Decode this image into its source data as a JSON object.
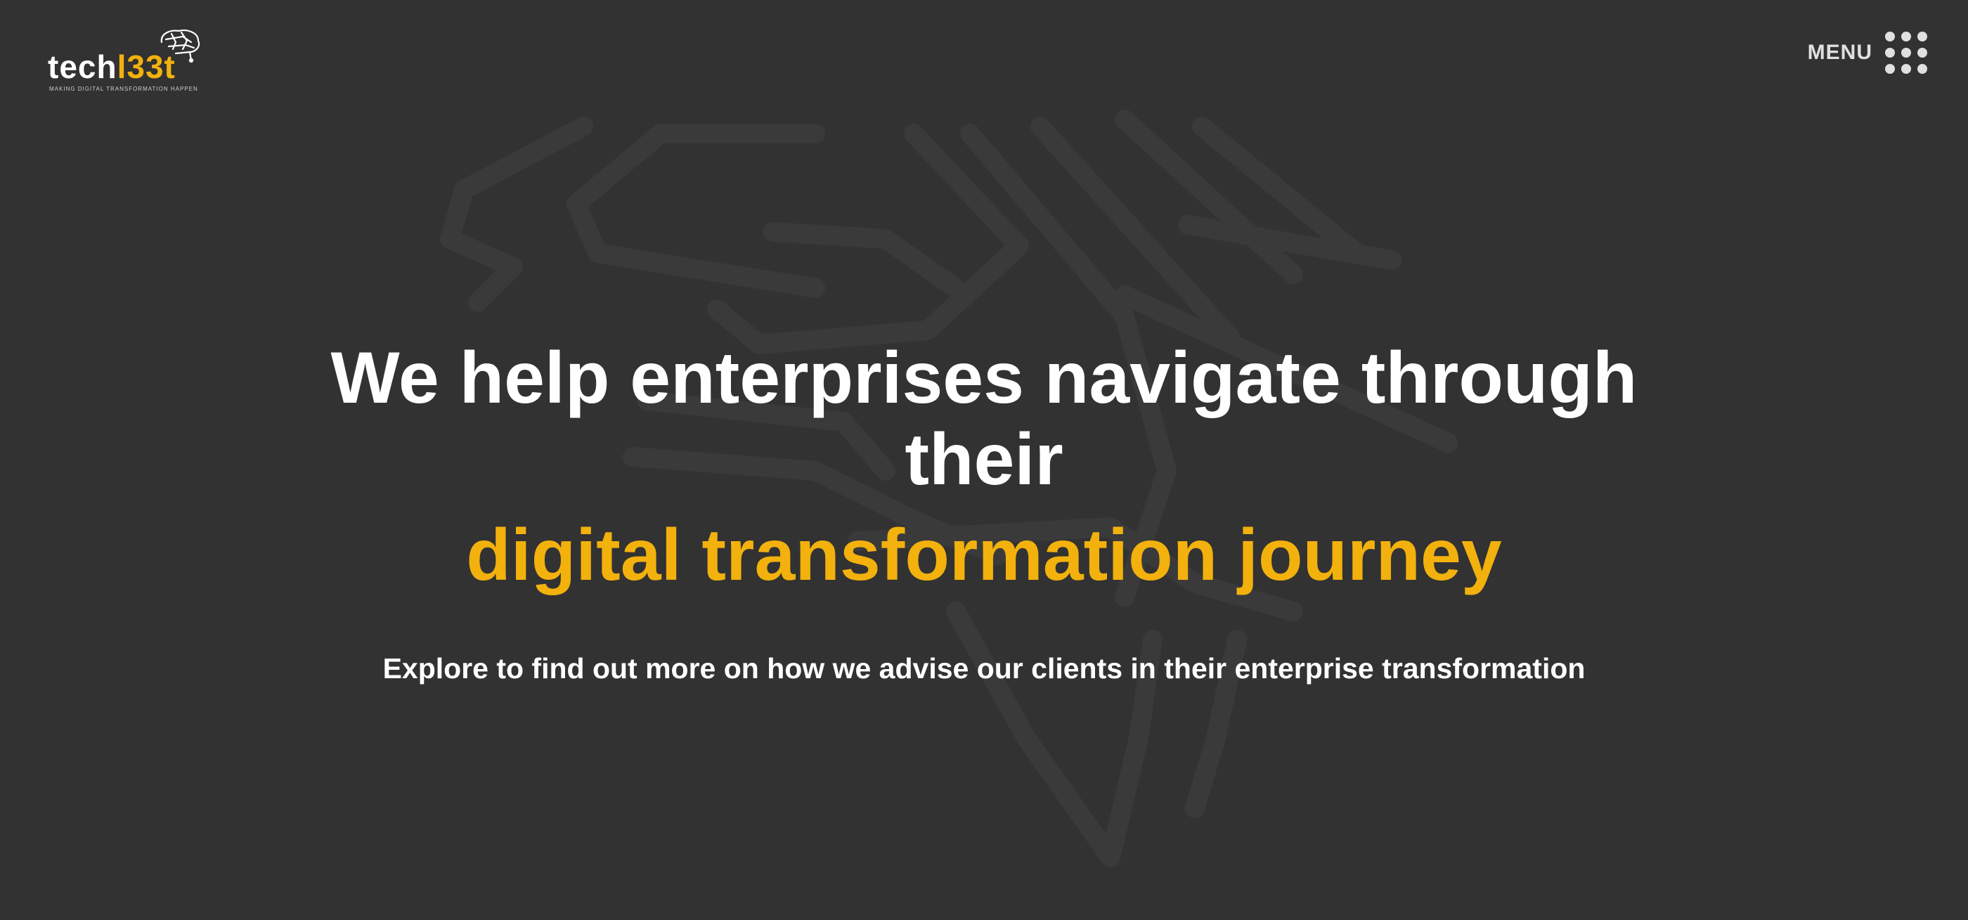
{
  "brand": {
    "name_part1": "tech",
    "name_part2": "l33t",
    "tagline": "MAKING DIGITAL TRANSFORMATION HAPPEN",
    "accent_color": "#f2b10d",
    "logo_icon": "brain-circuit-icon"
  },
  "nav": {
    "menu_label": "MENU",
    "menu_icon": "grid-dots-icon"
  },
  "hero": {
    "headline": "We help enterprises navigate through their",
    "highlight": "digital transformation journey",
    "subheadline": "Explore to find out more on how we advise our clients in their enterprise transformation"
  },
  "colors": {
    "background": "#323232",
    "text": "#ffffff",
    "accent": "#f2b10d"
  }
}
